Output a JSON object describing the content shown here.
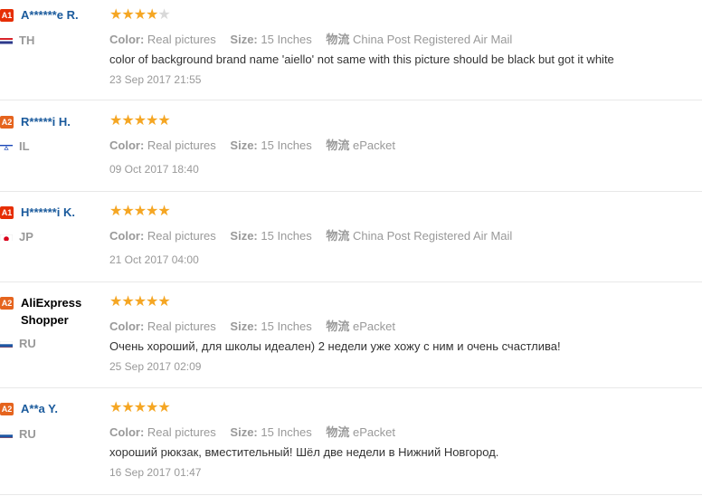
{
  "labels": {
    "color": "Color:",
    "size": "Size:",
    "shipping": "物流"
  },
  "reviews": [
    {
      "badge": "A1",
      "name": "A******e R.",
      "country": "TH",
      "flag": "th",
      "stars": 4,
      "color": "Real pictures",
      "size": "15 Inches",
      "shipping": "China Post Registered Air Mail",
      "text": "color of background brand name 'aiello' not same with this picture should be black but got it white",
      "date": "23 Sep 2017 21:55"
    },
    {
      "badge": "A2",
      "name": "R*****i H.",
      "country": "IL",
      "flag": "il",
      "stars": 5,
      "color": "Real pictures",
      "size": "15 Inches",
      "shipping": "ePacket",
      "text": "",
      "date": "09 Oct 2017 18:40"
    },
    {
      "badge": "A1",
      "name": "H******i K.",
      "country": "JP",
      "flag": "jp",
      "stars": 5,
      "color": "Real pictures",
      "size": "15 Inches",
      "shipping": "China Post Registered Air Mail",
      "text": "",
      "date": "21 Oct 2017 04:00"
    },
    {
      "badge": "A2",
      "name": "AliExpress Shopper",
      "country": "RU",
      "flag": "ru",
      "stars": 5,
      "color": "Real pictures",
      "size": "15 Inches",
      "shipping": "ePacket",
      "text": "Очень хороший, для школы идеален) 2 недели уже хожу с ним и очень счастлива!",
      "date": "25 Sep 2017 02:09"
    },
    {
      "badge": "A2",
      "name": "A**a Y.",
      "country": "RU",
      "flag": "ru",
      "stars": 5,
      "color": "Real pictures",
      "size": "15 Inches",
      "shipping": "ePacket",
      "text": "хороший рюкзак, вместительный! Шёл две недели в Нижний Новгород.",
      "date": "16 Sep 2017 01:47"
    }
  ]
}
